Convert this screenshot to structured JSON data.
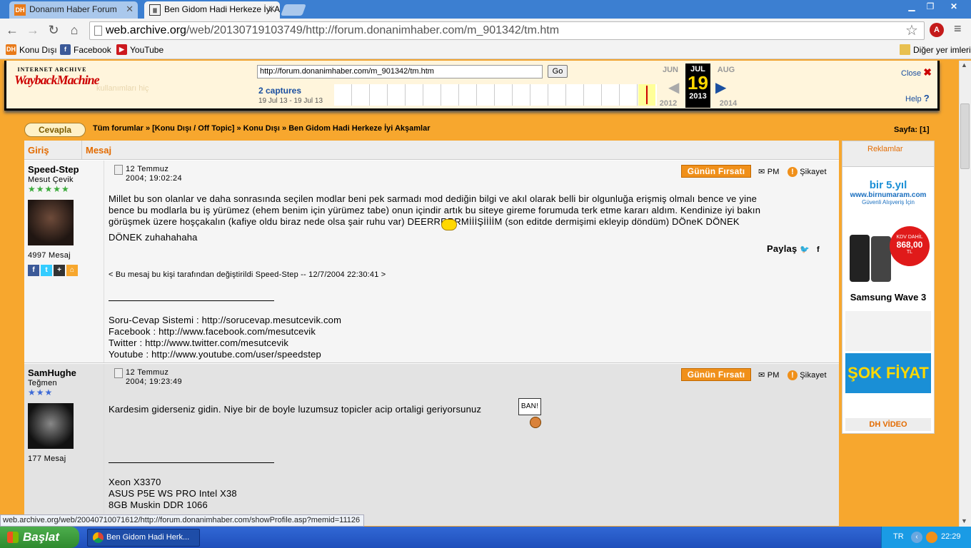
{
  "browser": {
    "tabs": [
      {
        "label": "Donanım Haber Forum",
        "icon": "DH"
      },
      {
        "label": "Ben Gidom Hadi Herkeze İyi A",
        "icon": "archive-icon"
      }
    ],
    "url_host": "web.archive.org",
    "url_rest": "/web/20130719103749/http://forum.donanimhaber.com/m_901342/tm.htm",
    "bookmarks": [
      {
        "label": "Konu Dışı",
        "icon": "DH"
      },
      {
        "label": "Facebook",
        "icon": "f"
      },
      {
        "label": "YouTube",
        "icon": "▶"
      }
    ],
    "other_bookmarks": "Diğer yer imleri"
  },
  "wayback": {
    "logo_line1": "INTERNET ARCHIVE",
    "logo_line2": "WaybackMachine",
    "url_value": "http://forum.donanimhaber.com/m_901342/tm.htm",
    "go": "Go",
    "captures": "2 captures",
    "range": "19 Jul 13 - 19 Jul 13",
    "prev_month": "JUN",
    "cur_month": "JUL",
    "next_month": "AUG",
    "day": "19",
    "prev_year": "2012",
    "cur_year": "2013",
    "next_year": "2014",
    "close": "Close",
    "help": "Help",
    "ghost_text": "kullanımları hiç"
  },
  "page": {
    "reply": "Cevapla",
    "breadcrumb": "Tüm forumlar » [Konu Dışı / Off Topic] » Konu Dışı » Ben Gidom Hadi Herkeze İyi Akşamlar",
    "pages_label": "Sayfa:",
    "pages_value": "[1]",
    "col1": "Giriş",
    "col2": "Mesaj",
    "ads_title": "Reklamlar"
  },
  "posts": [
    {
      "user": "Speed-Step",
      "title": "Mesut Çevik",
      "stars": "★★★★★",
      "count": "4997 Mesaj",
      "date1": "12 Temmuz",
      "date2": "2004; 19:02:24",
      "deal": "Günün Fırsatı",
      "pm": "PM",
      "report": "Şikayet",
      "lines": [
        "Millet bu son olanlar ve daha sonrasında seçilen modlar beni pek sarmadı mod dediğin bilgi ve akıl olarak belli bir olgunluğa erişmiş olmalı bence ve yine",
        "bence bu modlarla bu iş yürümez (ehem benim için yürümez tabe) onun içindir artık bu siteye gireme forumuda terk etme kararı aldım. Kendinize iyi bakın",
        "görüşmek üzere hoşçakalın (kafiye oldu biraz nede olsa şair ruhu var)      DEERRRRRMİİİŞİİİİM (son editde dermişimi ekleyip döndüm) DÖneK DÖNEK",
        "DÖNEK zuhahahaha"
      ],
      "share": "Paylaş",
      "edit": "< Bu mesaj bu kişi tarafından değiştirildi Speed-Step -- 12/7/2004 22:30:41 >",
      "sig": [
        "Soru-Cevap Sistemi : http://sorucevap.mesutcevik.com",
        "Facebook : http://www.facebook.com/mesutcevik",
        "Twitter : http://www.twitter.com/mesutcevik",
        "Youtube : http://www.youtube.com/user/speedstep"
      ]
    },
    {
      "user": "SamHughe",
      "title": "Teğmen",
      "stars": "★★★",
      "count": "177 Mesaj",
      "date1": "12 Temmuz",
      "date2": "2004; 19:23:49",
      "deal": "Günün Fırsatı",
      "pm": "PM",
      "report": "Şikayet",
      "lines": [
        "Kardesim giderseniz gidin. Niye bir de boyle luzumsuz topicler acip ortaligi geriyorsunuz"
      ],
      "ban": "BAN!",
      "sig": [
        "Xeon X3370",
        "ASUS P5E WS PRO Intel X38",
        "8GB Muskin DDR 1066"
      ]
    }
  ],
  "ads": {
    "brand": "bir 5.yıl",
    "site": "www.birnumaram.com",
    "tagline": "Güvenli Alışveriş İçin",
    "badge1": "KDV DAHİL",
    "price": "868,00",
    "currency": "TL",
    "product": "Samsung Wave 3",
    "sok": "ŞOK FİYAT",
    "video": "DH VİDEO"
  },
  "status_url": "web.archive.org/web/20040710071612/http://forum.donanimhaber.com/showProfile.asp?memid=11126",
  "taskbar": {
    "start": "Başlat",
    "task": "Ben Gidom Hadi Herk...",
    "lang": "TR",
    "clock": "22:29"
  }
}
